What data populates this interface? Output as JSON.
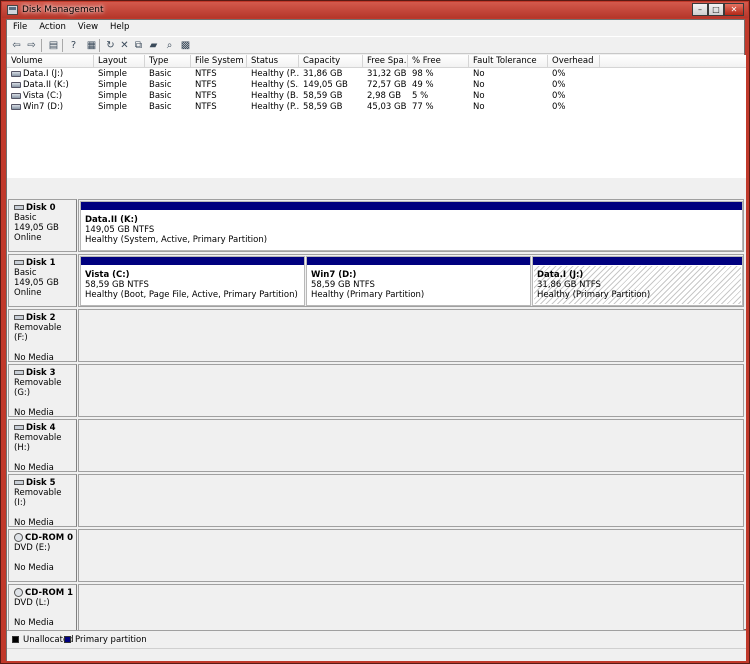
{
  "window": {
    "title": "Disk Management"
  },
  "menu": [
    "File",
    "Action",
    "View",
    "Help"
  ],
  "toolbar": [
    {
      "icon": "back-arrow-icon",
      "glyph": "⇦"
    },
    {
      "icon": "forward-arrow-icon",
      "glyph": "⇨"
    },
    {
      "icon": "console-tree-icon",
      "glyph": "▤"
    },
    {
      "icon": "help-icon",
      "glyph": "?"
    },
    {
      "icon": "properties-icon",
      "glyph": "▦"
    },
    {
      "icon": "refresh-icon",
      "glyph": "↻"
    },
    {
      "icon": "delete-icon",
      "glyph": "✕"
    },
    {
      "icon": "rescan-icon",
      "glyph": "⧉"
    },
    {
      "icon": "open-folder-icon",
      "glyph": "▰"
    },
    {
      "icon": "search-icon",
      "glyph": "⌕"
    },
    {
      "icon": "settings-icon",
      "glyph": "▩"
    }
  ],
  "volume_list": {
    "columns": [
      "Volume",
      "Layout",
      "Type",
      "File System",
      "Status",
      "Capacity",
      "Free Spa...",
      "% Free",
      "Fault Tolerance",
      "Overhead"
    ],
    "rows": [
      [
        "Data.I (J:)",
        "Simple",
        "Basic",
        "NTFS",
        "Healthy (P...",
        "31,86 GB",
        "31,32 GB",
        "98 %",
        "No",
        "0%"
      ],
      [
        "Data.II (K:)",
        "Simple",
        "Basic",
        "NTFS",
        "Healthy (S...",
        "149,05 GB",
        "72,57 GB",
        "49 %",
        "No",
        "0%"
      ],
      [
        "Vista (C:)",
        "Simple",
        "Basic",
        "NTFS",
        "Healthy (B...",
        "58,59 GB",
        "2,98 GB",
        "5 %",
        "No",
        "0%"
      ],
      [
        "Win7 (D:)",
        "Simple",
        "Basic",
        "NTFS",
        "Healthy (P...",
        "58,59 GB",
        "45,03 GB",
        "77 %",
        "No",
        "0%"
      ]
    ]
  },
  "disks": [
    {
      "name": "Disk 0",
      "line2": "Basic",
      "line3": "149,05 GB",
      "line4": "Online",
      "icon": "hard-disk-icon",
      "partitions": [
        {
          "name": "Data.II  (K:)",
          "size": "149,05 GB NTFS",
          "status": "Healthy (System, Active, Primary Partition)"
        }
      ]
    },
    {
      "name": "Disk 1",
      "line2": "Basic",
      "line3": "149,05 GB",
      "line4": "Online",
      "icon": "hard-disk-icon",
      "partitions": [
        {
          "name": "Vista  (C:)",
          "size": "58,59 GB NTFS",
          "status": "Healthy (Boot, Page File, Active, Primary Partition)"
        },
        {
          "name": "Win7  (D:)",
          "size": "58,59 GB NTFS",
          "status": "Healthy (Primary Partition)"
        },
        {
          "name": "Data.I  (J:)",
          "size": "31,86 GB NTFS",
          "status": "Healthy (Primary Partition)",
          "selected": true
        }
      ]
    },
    {
      "name": "Disk 2",
      "line2": "Removable (F:)",
      "line3": "",
      "line4": "No Media",
      "icon": "removable-disk-icon",
      "partitions": []
    },
    {
      "name": "Disk 3",
      "line2": "Removable (G:)",
      "line3": "",
      "line4": "No Media",
      "icon": "removable-disk-icon",
      "partitions": []
    },
    {
      "name": "Disk 4",
      "line2": "Removable (H:)",
      "line3": "",
      "line4": "No Media",
      "icon": "removable-disk-icon",
      "partitions": []
    },
    {
      "name": "Disk 5",
      "line2": "Removable (I:)",
      "line3": "",
      "line4": "No Media",
      "icon": "removable-disk-icon",
      "partitions": []
    },
    {
      "name": "CD-ROM 0",
      "line2": "DVD (E:)",
      "line3": "",
      "line4": "No Media",
      "icon": "cd-rom-icon",
      "partitions": []
    },
    {
      "name": "CD-ROM 1",
      "line2": "DVD (L:)",
      "line3": "",
      "line4": "No Media",
      "icon": "cd-rom-icon",
      "partitions": []
    }
  ],
  "legend": [
    {
      "label": "Unallocated",
      "color": "#000000"
    },
    {
      "label": "Primary partition",
      "color": "#00007f"
    }
  ],
  "colors": {
    "primary_partition": "#00007f",
    "unallocated": "#000000",
    "window_frame": "#c0392b"
  }
}
